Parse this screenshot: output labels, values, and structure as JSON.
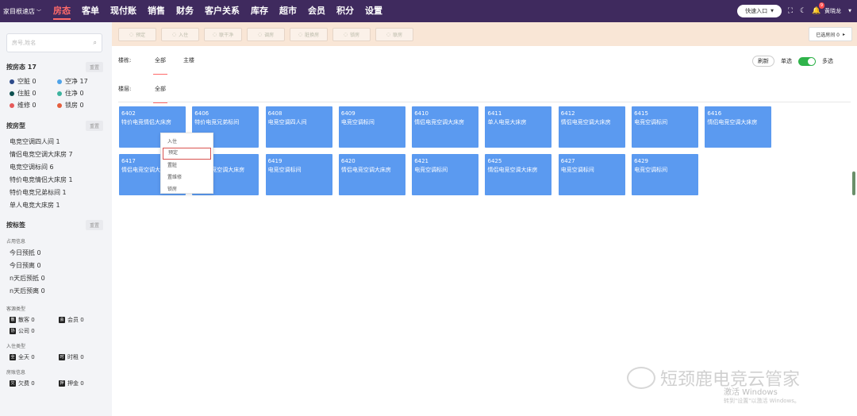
{
  "topbar": {
    "store": "家目根速店",
    "nav": [
      "房态",
      "客单",
      "现付账",
      "销售",
      "财务",
      "客户关系",
      "库存",
      "超市",
      "会员",
      "积分",
      "设置"
    ],
    "active_nav": 0,
    "quick_entry": "快速入口",
    "notification_count": "9",
    "user": "黄晓龙"
  },
  "sidebar": {
    "search_placeholder": "房号,姓名",
    "room_status": {
      "title": "按房态 17",
      "reset": "重置",
      "items": [
        {
          "label": "空脏 0",
          "color": "#2d4a8a"
        },
        {
          "label": "空净 17",
          "color": "#4fa3e8"
        },
        {
          "label": "住脏 0",
          "color": "#0d4f4f"
        },
        {
          "label": "住净 0",
          "color": "#3db39e"
        },
        {
          "label": "维修 0",
          "color": "#e65a5a"
        },
        {
          "label": "锁房 0",
          "color": "#e45e3d"
        }
      ]
    },
    "room_type": {
      "title": "按房型",
      "reset": "重置",
      "items": [
        "电竞空调四人间 1",
        "情侣电竞空调大床房 7",
        "电竞空调标间 6",
        "特价电竞情侣大床房 1",
        "特价电竞兄弟标间 1",
        "单人电竞大床房 1"
      ]
    },
    "tags": {
      "title": "按标签",
      "reset": "重置",
      "occupancy_title": "占用信息",
      "occupancy": [
        "今日预抵 0",
        "今日预离 0",
        "n天后预抵 0",
        "n天后预离 0"
      ],
      "source_title": "客源类型",
      "source": [
        {
          "icon": "散",
          "label": "散客 0"
        },
        {
          "icon": "会",
          "label": "会员 0"
        },
        {
          "icon": "协",
          "label": "公司 0"
        }
      ],
      "checkin_title": "入住类型",
      "checkin": [
        {
          "icon": "全",
          "label": "全天 0"
        },
        {
          "icon": "时",
          "label": "时租 0"
        }
      ],
      "account_title": "房账信息",
      "account": [
        {
          "icon": "欠",
          "label": "欠费 0"
        },
        {
          "icon": "押",
          "label": "押金 0"
        }
      ]
    }
  },
  "main": {
    "actions": [
      "预定",
      "入住",
      "联干净",
      "调房",
      "脏换房",
      "锁房",
      "联房"
    ],
    "selected_rooms": "已选房间 0",
    "building_label": "楼栋:",
    "building_tabs": [
      "全部",
      "主楼"
    ],
    "floor_label": "楼层:",
    "floor_tabs": [
      "全部"
    ],
    "refresh": "刷新",
    "single": "单选",
    "multi": "多选",
    "rooms": [
      {
        "num": "6402",
        "type": "特价电竞情侣大床房"
      },
      {
        "num": "6406",
        "type": "特价电竞兄弟标间"
      },
      {
        "num": "6408",
        "type": "电竞空调四人间"
      },
      {
        "num": "6409",
        "type": "电竞空调标间"
      },
      {
        "num": "6410",
        "type": "情侣电竞空调大床房"
      },
      {
        "num": "6411",
        "type": "单人电竞大床房"
      },
      {
        "num": "6412",
        "type": "情侣电竞空调大床房"
      },
      {
        "num": "6415",
        "type": "电竞空调标间"
      },
      {
        "num": "6416",
        "type": "情侣电竞空调大床房"
      },
      {
        "num": "6417",
        "type": "情侣电竞空调大床房"
      },
      {
        "num": "6418",
        "type": "情侣电竞空调大床房"
      },
      {
        "num": "6419",
        "type": "电竞空调标间"
      },
      {
        "num": "6420",
        "type": "情侣电竞空调大床房"
      },
      {
        "num": "6421",
        "type": "电竞空调标间"
      },
      {
        "num": "6425",
        "type": "情侣电竞空调大床房"
      },
      {
        "num": "6427",
        "type": "电竞空调标间"
      },
      {
        "num": "6429",
        "type": "电竞空调标间"
      }
    ],
    "context_menu": [
      "入住",
      "预定",
      "置脏",
      "置维修",
      "锁房"
    ],
    "context_highlight": 1
  },
  "watermark": {
    "brand": "短颈鹿电竞云管家",
    "activate_line1": "激活 Windows",
    "activate_line2": "转到\"设置\"以激活 Windows。"
  }
}
